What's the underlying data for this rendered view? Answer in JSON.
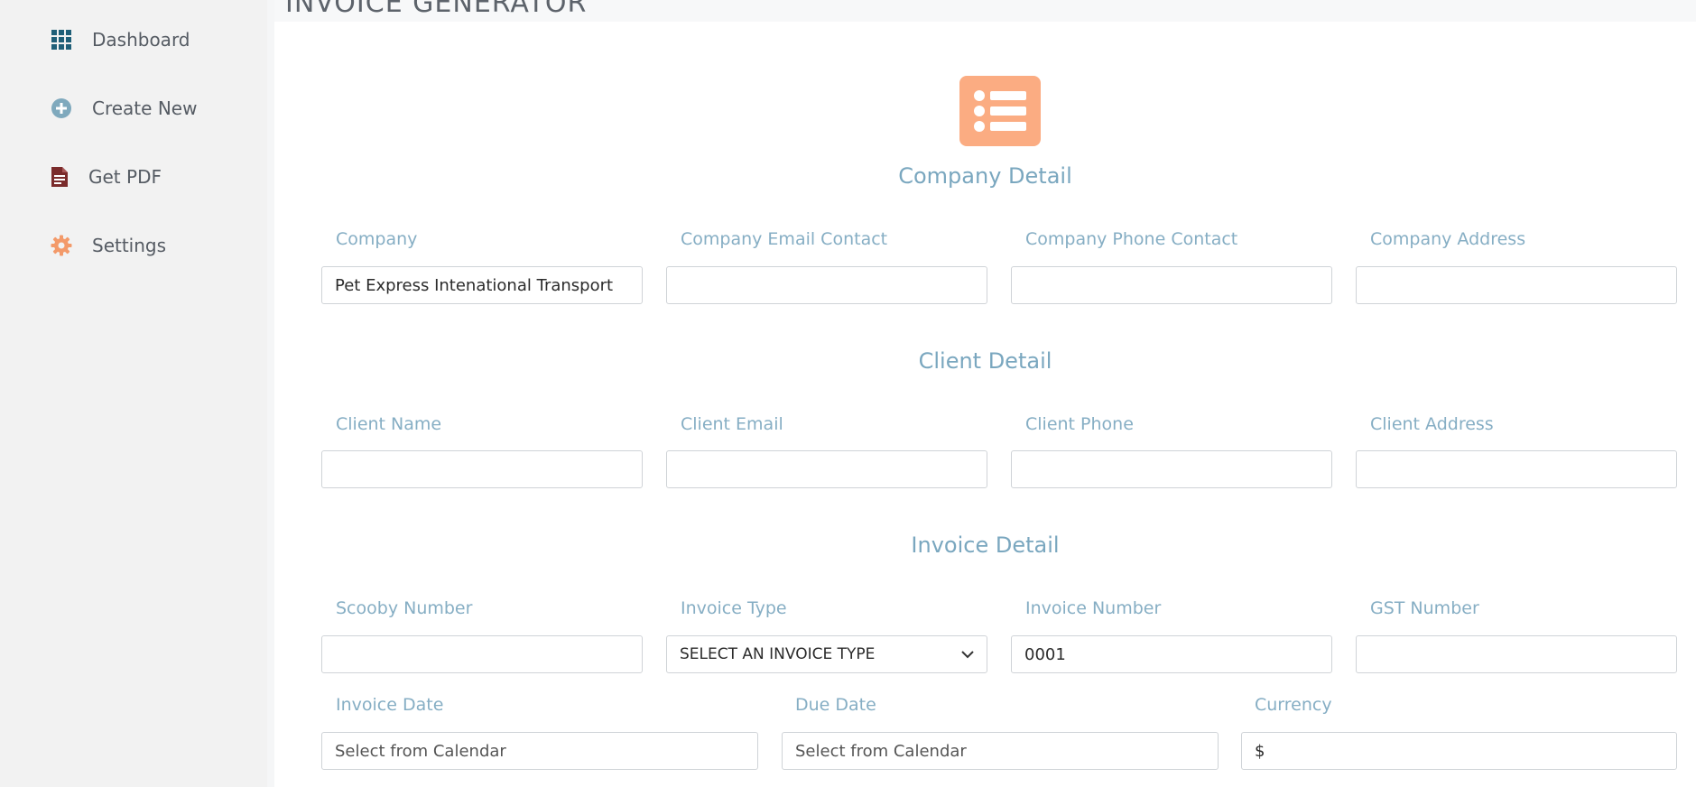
{
  "app": {
    "title": "INVOICE GENERATOR"
  },
  "sidebar": {
    "items": [
      {
        "label": "Dashboard",
        "icon": "grid-icon"
      },
      {
        "label": "Create New",
        "icon": "plus-circle-icon"
      },
      {
        "label": "Get PDF",
        "icon": "pdf-file-icon"
      },
      {
        "label": "Settings",
        "icon": "gear-icon"
      }
    ]
  },
  "colors": {
    "accent_orange": "#fbac82",
    "label_blue": "#86aec4",
    "section_blue": "#7aa7bf",
    "dashboard_icon": "#1f5f78",
    "pdf_icon": "#7a2b2b"
  },
  "hero": {
    "icon": "list-icon"
  },
  "company": {
    "title": "Company Detail",
    "company_label": "Company",
    "company_value": "Pet Express Intenational Transport",
    "email_label": "Company Email Contact",
    "email_value": "",
    "phone_label": "Company Phone Contact",
    "phone_value": "",
    "address_label": "Company Address",
    "address_value": ""
  },
  "client": {
    "title": "Client Detail",
    "name_label": "Client Name",
    "name_value": "",
    "email_label": "Client Email",
    "email_value": "",
    "phone_label": "Client Phone",
    "phone_value": "",
    "address_label": "Client Address",
    "address_value": ""
  },
  "invoice": {
    "title": "Invoice Detail",
    "scooby_label": "Scooby Number",
    "scooby_value": "",
    "type_label": "Invoice Type",
    "type_selected": "SELECT AN INVOICE TYPE",
    "number_label": "Invoice Number",
    "number_value": "0001",
    "gst_label": "GST Number",
    "gst_value": "",
    "date_label": "Invoice Date",
    "date_placeholder": "Select from Calendar",
    "due_label": "Due Date",
    "due_placeholder": "Select from Calendar",
    "currency_label": "Currency",
    "currency_value": "$"
  }
}
